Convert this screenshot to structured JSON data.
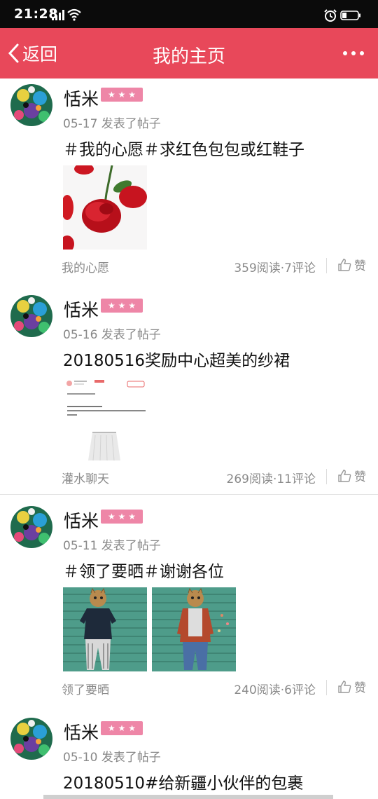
{
  "status_bar": {
    "time": "21:28",
    "signal_label": "3G"
  },
  "nav": {
    "back_label": "返回",
    "title": "我的主页",
    "more_icon": "more-dots-icon"
  },
  "posts": [
    {
      "user": "恬米",
      "level_stars": "★ ★ ★",
      "meta": "05-17 发表了帖子",
      "title": "＃我的心愿＃求红色包包或红鞋子",
      "category": "我的心愿",
      "stats": "359阅读·7评论",
      "like_label": "赞",
      "images": [
        "red-rose-photo"
      ]
    },
    {
      "user": "恬米",
      "level_stars": "★ ★ ★",
      "meta": "05-16 发表了帖子",
      "title": "20180516奖励中心超美的纱裙",
      "category": "灌水聊天",
      "stats": "269阅读·11评论",
      "like_label": "赞",
      "images": [
        "skirt-order-screenshot"
      ]
    },
    {
      "user": "恬米",
      "level_stars": "★ ★ ★",
      "meta": "05-11 发表了帖子",
      "title": "＃领了要晒＃谢谢各位",
      "category": "领了要晒",
      "stats": "240阅读·6评论",
      "like_label": "赞",
      "images": [
        "tshirt-outfit-photo",
        "red-shirt-outfit-photo"
      ]
    },
    {
      "user": "恬米",
      "level_stars": "★ ★ ★",
      "meta": "05-10 发表了帖子",
      "title": "20180510#给新疆小伙伴的包裹"
    }
  ],
  "colors": {
    "nav_bg": "#e8485a",
    "level_badge": "#ee86a7",
    "status_bg": "#0b0b0b"
  }
}
